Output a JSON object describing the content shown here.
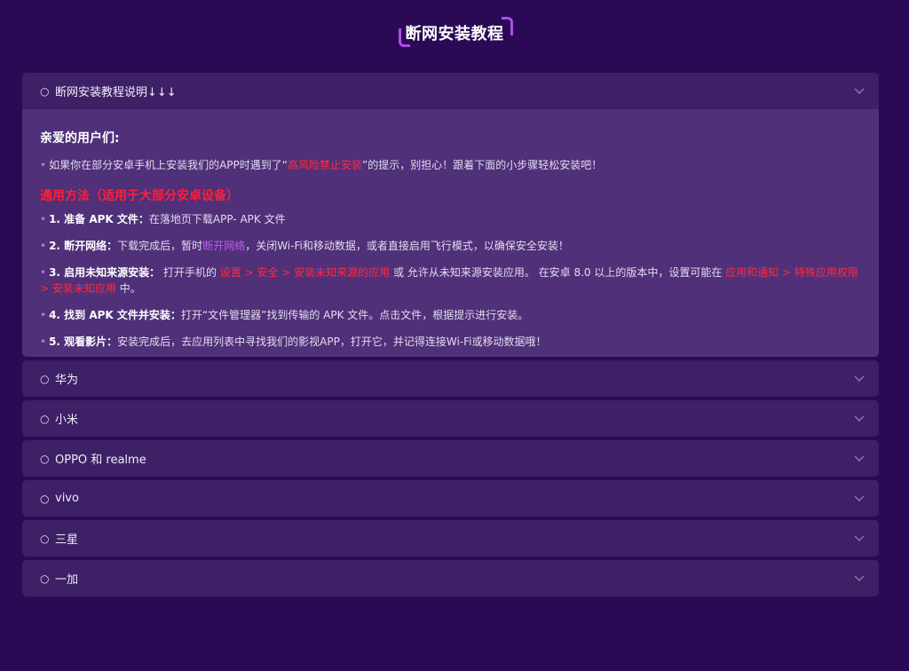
{
  "page": {
    "title": "断网安装教程"
  },
  "accordion": {
    "open_item": {
      "header": "断网安装教程说明↓↓↓",
      "greeting": "亲爱的用户们:",
      "intro": {
        "before": "如果你在部分安卓手机上安装我们的APP时遇到了“",
        "highlight": "高风险禁止安装",
        "after": "”的提示，别担心！跟着下面的小步骤轻松安装吧！"
      },
      "section_title": "通用方法（适用于大部分安卓设备）",
      "steps": [
        {
          "label": "1. 准备 APK 文件：",
          "text": "在落地页下载APP- APK 文件"
        },
        {
          "label": "2. 断开网络：",
          "text_before": "下载完成后，暂时",
          "highlight": "断开网络",
          "text_after": "，关闭Wi-Fi和移动数据，或者直接启用飞行模式，以确保安全安装！"
        },
        {
          "label": "3. 启用未知来源安装：",
          "text_before": " 打开手机的 ",
          "highlight1": "设置 > 安全 > 安装未知来源的应用",
          "text_mid": " 或 允许从未知来源安装应用。 在安卓 8.0 以上的版本中，设置可能在 ",
          "highlight2": "应用和通知 > 特殊应用权限 > 安装未知应用",
          "text_after": " 中。"
        },
        {
          "label": "4. 找到 APK 文件并安装：",
          "text": "打开“文件管理器”找到传输的 APK 文件。点击文件，根据提示进行安装。"
        },
        {
          "label": "5. 观看影片：",
          "text": "安装完成后，去应用列表中寻找我们的影视APP，打开它，并记得连接Wi-Fi或移动数据哦！"
        }
      ]
    },
    "items": [
      {
        "label": "华为"
      },
      {
        "label": "小米"
      },
      {
        "label": "OPPO 和 realme"
      },
      {
        "label": "vivo"
      },
      {
        "label": "三星"
      },
      {
        "label": "一加"
      }
    ]
  },
  "icons": {
    "bullet": "○",
    "bullet_dot": "•",
    "chevron": "chevron-down-icon"
  },
  "colors": {
    "background": "#2a0a55",
    "panel": "#3e2067",
    "panel_body": "#4f3079",
    "accent_purple": "#b14ce6",
    "highlight_red": "#ff2b3e"
  }
}
